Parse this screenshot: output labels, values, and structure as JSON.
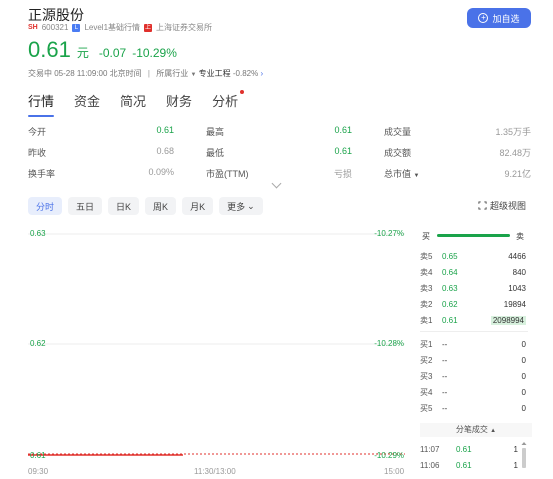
{
  "header": {
    "name": "正源股份",
    "exchange_tag": "SH",
    "code": "600321",
    "level_tag": "Level1基础行情",
    "exchange_name": "上海证券交易所",
    "price": "0.61",
    "unit": "元",
    "change": "-0.07",
    "change_pct": "-10.29%",
    "trade_time": "交易中 05-28 11:09:00 北京时间",
    "industry_label": "所属行业",
    "industry_name": "专业工程",
    "industry_chg": "-0.82%",
    "add_button": "加自选"
  },
  "tabs": [
    {
      "label": "行情",
      "active": true
    },
    {
      "label": "资金"
    },
    {
      "label": "简况"
    },
    {
      "label": "财务"
    },
    {
      "label": "分析",
      "dot": true
    }
  ],
  "stats": {
    "col1": [
      {
        "label": "今开",
        "value": "0.61",
        "color": "green"
      },
      {
        "label": "昨收",
        "value": "0.68",
        "color": "gray"
      },
      {
        "label": "换手率",
        "value": "0.09%",
        "color": "gray"
      }
    ],
    "col2": [
      {
        "label": "最高",
        "value": "0.61",
        "color": "green"
      },
      {
        "label": "最低",
        "value": "0.61",
        "color": "green"
      },
      {
        "label": "市盈(TTM)",
        "value": "亏损",
        "color": "gray"
      }
    ],
    "col3": [
      {
        "label": "成交量",
        "value": "1.35万手",
        "color": "gray"
      },
      {
        "label": "成交额",
        "value": "82.48万",
        "color": "gray"
      },
      {
        "label": "总市值",
        "value": "9.21亿",
        "color": "gray"
      }
    ]
  },
  "chips": [
    "分时",
    "五日",
    "日K",
    "周K",
    "月K",
    "更多"
  ],
  "super_view": "超级视图",
  "chart": {
    "y_labels": [
      "0.63",
      "0.62",
      "0.61"
    ],
    "pct_labels": [
      "-10.27%",
      "-10.28%",
      "-10.29%"
    ],
    "x_labels": [
      "09:30",
      "11:30/13:00",
      "15:00"
    ],
    "line_color": "#e0302c"
  },
  "orderbook": {
    "buy_label": "买",
    "sell_label": "卖",
    "asks": [
      {
        "label": "卖5",
        "price": "0.65",
        "vol": "4466"
      },
      {
        "label": "卖4",
        "price": "0.64",
        "vol": "840"
      },
      {
        "label": "卖3",
        "price": "0.63",
        "vol": "1043"
      },
      {
        "label": "卖2",
        "price": "0.62",
        "vol": "19894"
      },
      {
        "label": "卖1",
        "price": "0.61",
        "vol": "2098994"
      }
    ],
    "bids": [
      {
        "label": "买1",
        "price": "--",
        "vol": "0"
      },
      {
        "label": "买2",
        "price": "--",
        "vol": "0"
      },
      {
        "label": "买3",
        "price": "--",
        "vol": "0"
      },
      {
        "label": "买4",
        "price": "--",
        "vol": "0"
      },
      {
        "label": "买5",
        "price": "--",
        "vol": "0"
      }
    ]
  },
  "ticks": {
    "header": "分笔成交",
    "rows": [
      {
        "time": "11:07",
        "price": "0.61",
        "vol": "1"
      },
      {
        "time": "11:06",
        "price": "0.61",
        "vol": "1"
      }
    ]
  }
}
